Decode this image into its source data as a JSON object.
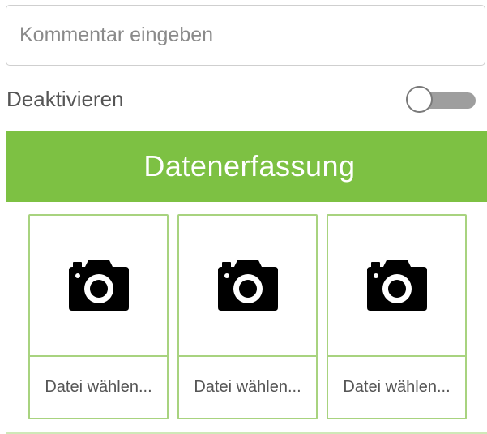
{
  "comment": {
    "placeholder": "Kommentar eingeben",
    "value": ""
  },
  "deactivate": {
    "label": "Deaktivieren",
    "enabled": false
  },
  "header": {
    "title": "Datenerfassung",
    "color": "#7dc143"
  },
  "file_slots": [
    {
      "icon": "camera-icon",
      "label": "Datei wählen..."
    },
    {
      "icon": "camera-icon",
      "label": "Datei wählen..."
    },
    {
      "icon": "camera-icon",
      "label": "Datei wählen..."
    }
  ],
  "colors": {
    "accent_green": "#7dc143",
    "card_border": "#a8d37f",
    "toggle_off": "#9e9e9e"
  }
}
